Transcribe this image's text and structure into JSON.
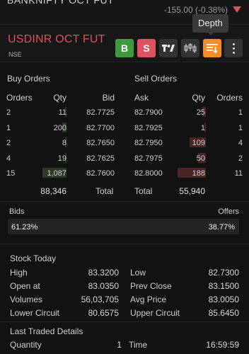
{
  "top": {
    "symbol": "BANKNIFTY OCT FUT",
    "change": "-155.00 (-0.38%)"
  },
  "header": {
    "instrument": "USDINR OCT FUT",
    "exchange": "NSE",
    "buy_label": "B",
    "sell_label": "S",
    "tooltip": "Depth"
  },
  "depth": {
    "buy_title": "Buy Orders",
    "sell_title": "Sell Orders",
    "headers": {
      "orders": "Orders",
      "qty": "Qty",
      "bid": "Bid",
      "ask": "Ask",
      "qty2": "Qty",
      "orders2": "Orders"
    },
    "bids": [
      {
        "orders": "2",
        "qty": "11",
        "price": "82.7725",
        "fill": 0.01
      },
      {
        "orders": "1",
        "qty": "200",
        "price": "82.7700",
        "fill": 0.18
      },
      {
        "orders": "2",
        "qty": "8",
        "price": "82.7650",
        "fill": 0.01
      },
      {
        "orders": "4",
        "qty": "19",
        "price": "82.7625",
        "fill": 0.02
      },
      {
        "orders": "15",
        "qty": "1,087",
        "price": "82.7600",
        "fill": 1.0
      }
    ],
    "asks": [
      {
        "price": "82.7900",
        "qty": "25",
        "orders": "1",
        "fill": 0.13
      },
      {
        "price": "82.7925",
        "qty": "1",
        "orders": "1",
        "fill": 0.01
      },
      {
        "price": "82.7950",
        "qty": "109",
        "orders": "4",
        "fill": 0.58
      },
      {
        "price": "82.7975",
        "qty": "50",
        "orders": "2",
        "fill": 0.27
      },
      {
        "price": "82.8000",
        "qty": "188",
        "orders": "11",
        "fill": 1.0
      }
    ],
    "bid_total": "88,346",
    "total_label": "Total",
    "ask_total": "55,940",
    "total_label2": "Total"
  },
  "ratio": {
    "bids_label": "Bids",
    "offers_label": "Offers",
    "bids_pct": "61.23%",
    "offers_pct": "38.77%",
    "bids_fraction": 0.6123
  },
  "stock_today": {
    "title": "Stock Today",
    "left": [
      {
        "label": "High",
        "value": "83.3200"
      },
      {
        "label": "Open at",
        "value": "83.0350"
      },
      {
        "label": "Volumes",
        "value": "56,03,705"
      },
      {
        "label": "Lower Circuit",
        "value": "80.6575"
      }
    ],
    "right": [
      {
        "label": "Low",
        "value": "82.7300"
      },
      {
        "label": "Prev Close",
        "value": "83.1500"
      },
      {
        "label": "Avg Price",
        "value": "83.0050"
      },
      {
        "label": "Upper Circuit",
        "value": "85.6450"
      }
    ]
  },
  "last_traded": {
    "title": "Last Traded Details",
    "quantity_label": "Quantity",
    "quantity_value": "1",
    "time_label": "Time",
    "time_value": "16:59:59"
  },
  "colors": {
    "buy": "#3d9a3d",
    "sell": "#df5360",
    "depth_active": "#f78b24",
    "bid_bar": "#2c3a28",
    "ask_bar": "#4a2526"
  },
  "icons": [
    "tradingview-icon",
    "candlestick-chart-icon",
    "market-depth-icon",
    "more-vertical-icon",
    "down-triangle-icon"
  ]
}
